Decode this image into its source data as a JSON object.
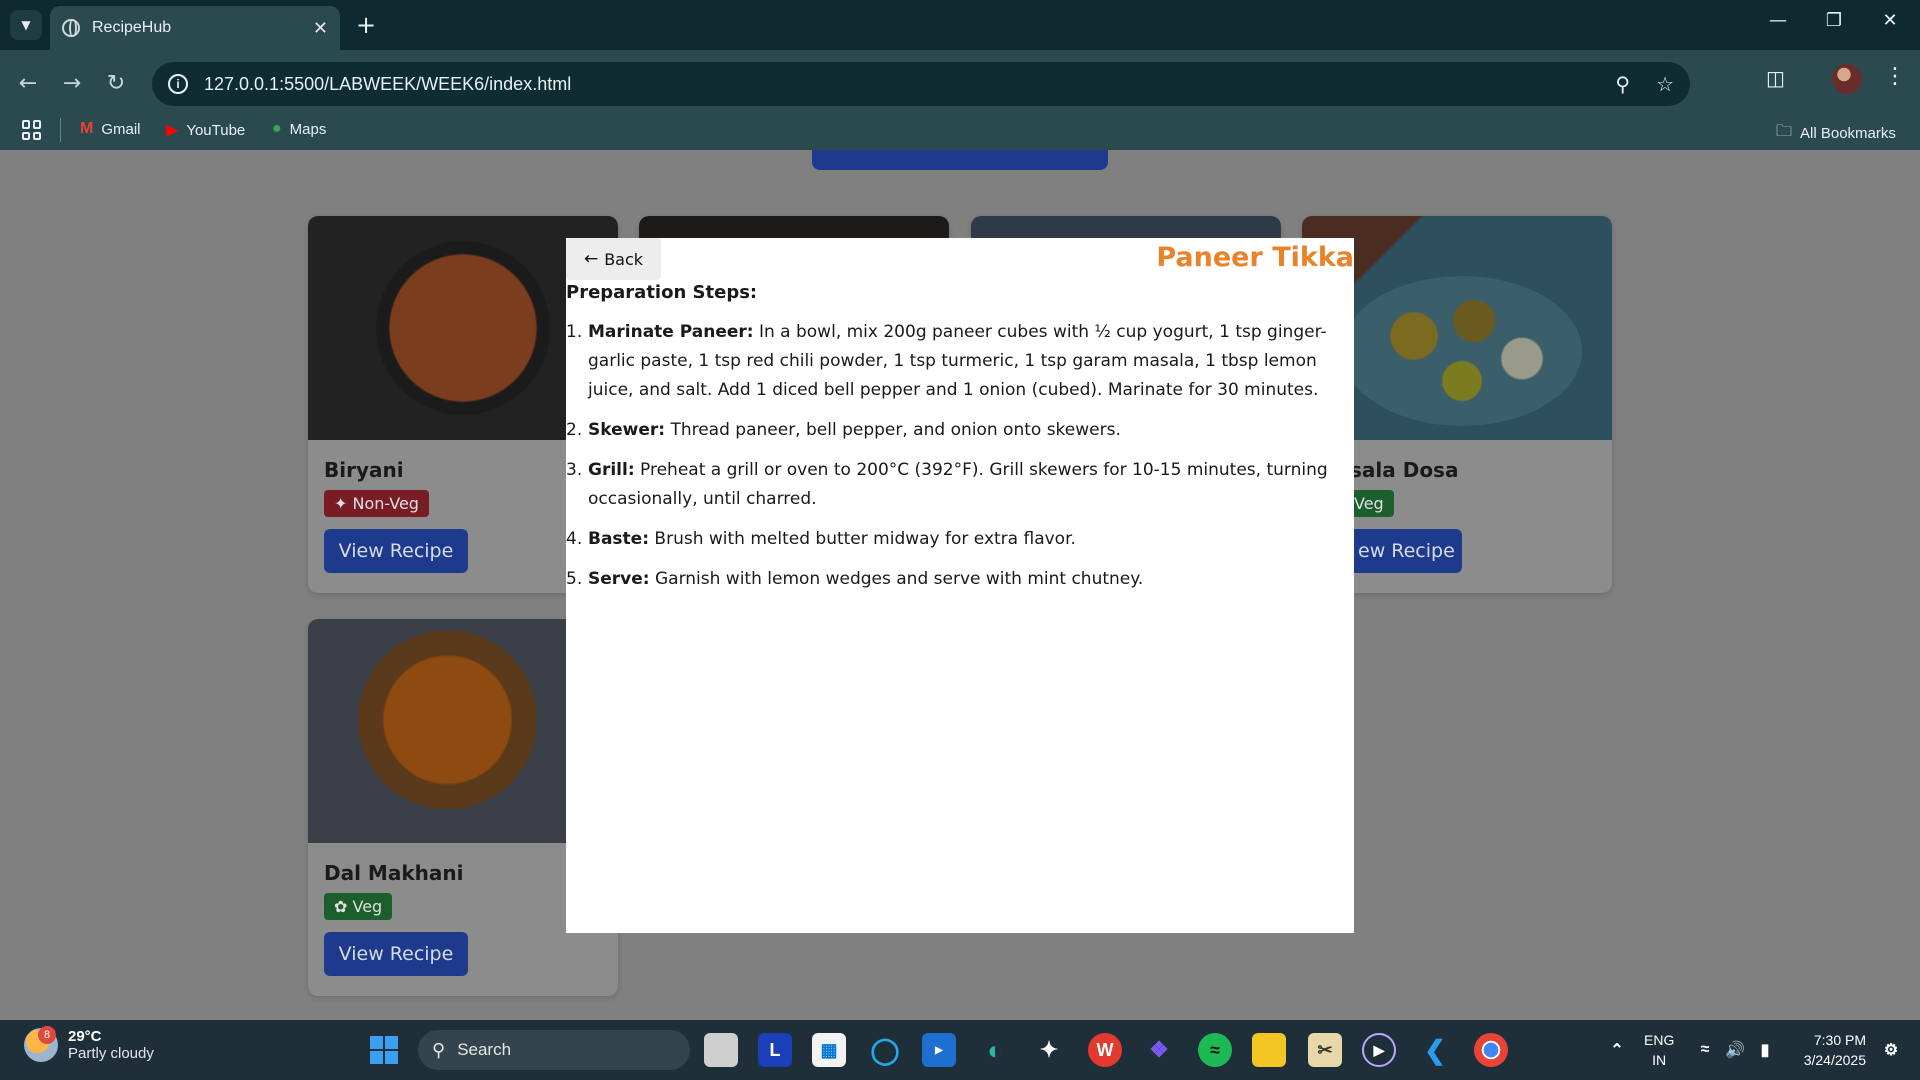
{
  "browser": {
    "tab_title": "RecipeHub",
    "url": "127.0.0.1:5500/LABWEEK/WEEK6/index.html",
    "bookmarks": [
      "Gmail",
      "YouTube",
      "Maps"
    ],
    "all_bookmarks": "All Bookmarks"
  },
  "cards": [
    {
      "title": "Biryani",
      "badge": "Non-Veg",
      "button": "View Recipe"
    },
    {
      "title": "salа Dosa",
      "badge": "Veg",
      "button": "ew Recipe"
    },
    {
      "title": "Dal Makhani",
      "badge": "Veg",
      "button": "View Recipe"
    }
  ],
  "modal": {
    "back_label": "Back",
    "title": "Paneer Tikka",
    "steps_heading": "Preparation Steps:",
    "steps": [
      {
        "num": "1.",
        "label": "Marinate Paneer:",
        "text": " In a bowl, mix 200g paneer cubes with ½ cup yogurt, 1 tsp ginger-garlic paste, 1 tsp red chili powder, 1 tsp turmeric, 1 tsp garam masala, 1 tbsp lemon juice, and salt. Add 1 diced bell pepper and 1 onion (cubed). Marinate for 30 minutes."
      },
      {
        "num": "2.",
        "label": "Skewer:",
        "text": " Thread paneer, bell pepper, and onion onto skewers."
      },
      {
        "num": "3.",
        "label": "Grill:",
        "text": " Preheat a grill or oven to 200°C (392°F). Grill skewers for 10-15 minutes, turning occasionally, until charred."
      },
      {
        "num": "4.",
        "label": "Baste:",
        "text": " Brush with melted butter midway for extra flavor."
      },
      {
        "num": "5.",
        "label": "Serve:",
        "text": " Garnish with lemon wedges and serve with mint chutney."
      }
    ]
  },
  "taskbar": {
    "weather_alert": "8",
    "temperature": "29°C",
    "condition": "Partly cloudy",
    "search_placeholder": "Search",
    "lang_top": "ENG",
    "lang_bottom": "IN",
    "time": "7:30 PM",
    "date": "3/24/2025"
  }
}
